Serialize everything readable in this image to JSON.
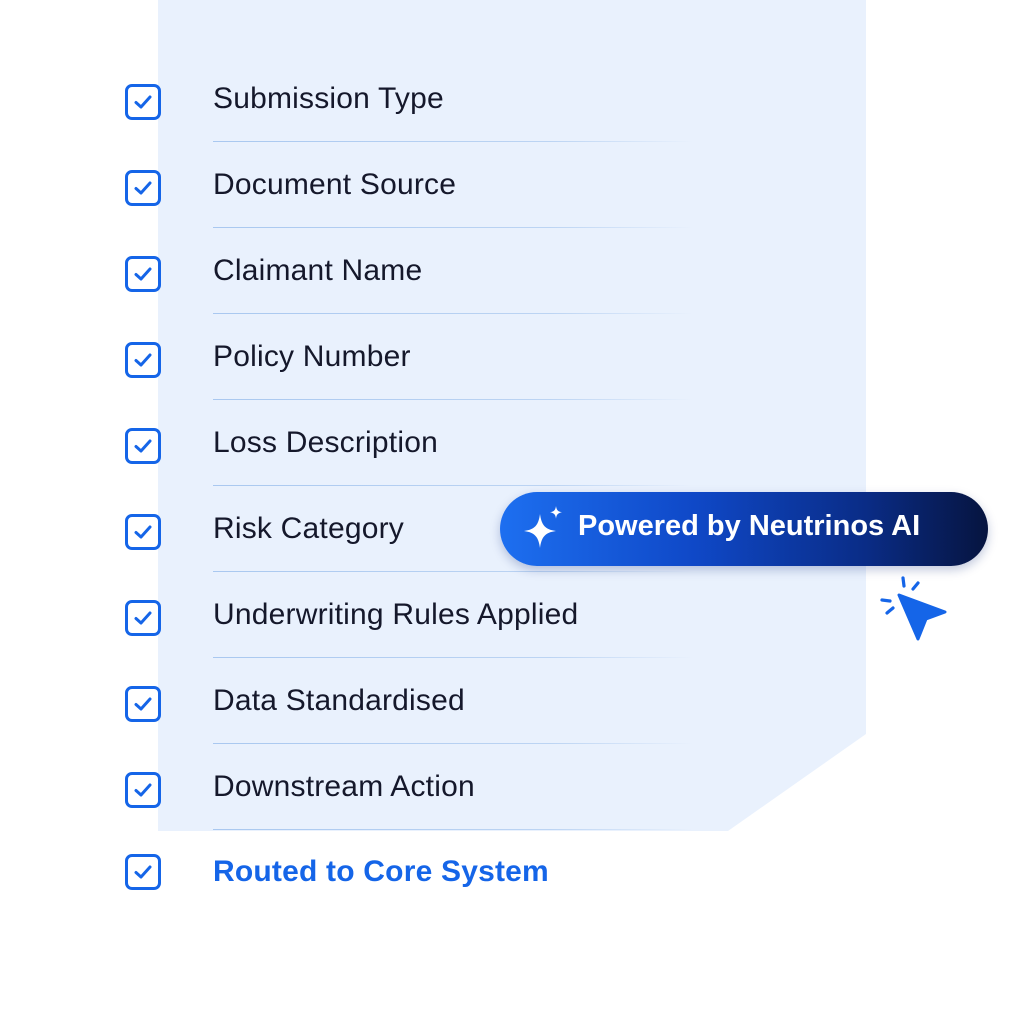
{
  "checklist": {
    "items": [
      {
        "label": "Submission Type",
        "checked": true
      },
      {
        "label": "Document Source",
        "checked": true
      },
      {
        "label": "Claimant Name",
        "checked": true
      },
      {
        "label": "Policy Number",
        "checked": true
      },
      {
        "label": "Loss Description",
        "checked": true
      },
      {
        "label": "Risk Category",
        "checked": true
      },
      {
        "label": "Underwriting Rules Applied",
        "checked": true
      },
      {
        "label": "Data Standardised",
        "checked": true
      },
      {
        "label": "Downstream Action",
        "checked": true
      },
      {
        "label": "Routed to Core System",
        "checked": true
      }
    ]
  },
  "badge": {
    "text": "Powered by Neutrinos AI",
    "icon": "sparkle-icon"
  },
  "cursor": {
    "icon": "click-cursor-icon"
  },
  "colors": {
    "accent": "#1565e8",
    "panel": "#e9f1fd",
    "text": "#15182b",
    "badge_start": "#1d6ff0",
    "badge_end": "#06143f"
  }
}
